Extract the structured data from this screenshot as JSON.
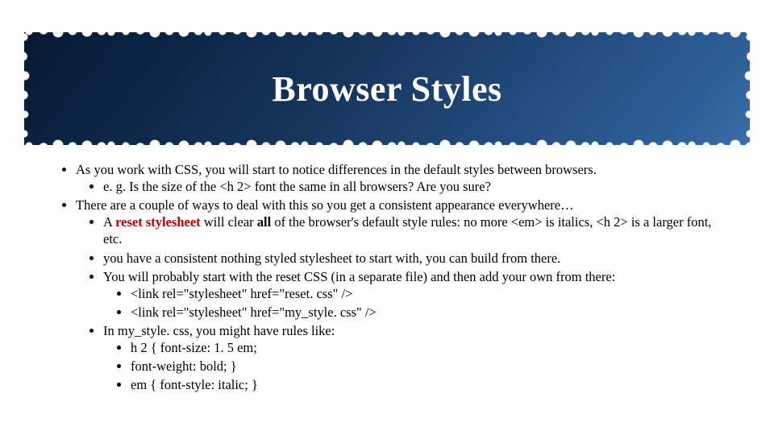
{
  "title": "Browser Styles",
  "bullets": {
    "b1": "As you work with CSS, you will start to notice differences in the default styles between browsers.",
    "b1a": "e. g. Is the size of the <h 2> font the same in all browsers? Are you sure?",
    "b2": "There are a couple of ways to deal with this so you get a consistent appearance everywhere…",
    "b2a_pre": "A ",
    "b2a_hl": "reset stylesheet",
    "b2a_mid": " will clear ",
    "b2a_bold": "all",
    "b2a_post": " of the browser's default style rules: no more <em> is italics, <h 2> is a larger font, etc.",
    "b2b": "you have a consistent nothing styled stylesheet to start with, you can build from there.",
    "b2c": "You will probably start with the reset CSS (in a separate file) and then add your own from there:",
    "b2c1": "<link rel=\"stylesheet\" href=\"reset. css\" />",
    "b2c2": "<link rel=\"stylesheet\" href=\"my_style. css\" />",
    "b2d": "In my_style. css, you might have rules like:",
    "b2d1": "h 2 { font-size: 1. 5 em;",
    "b2d2": "font-weight: bold; }",
    "b2d3": "em { font-style: italic; }"
  }
}
